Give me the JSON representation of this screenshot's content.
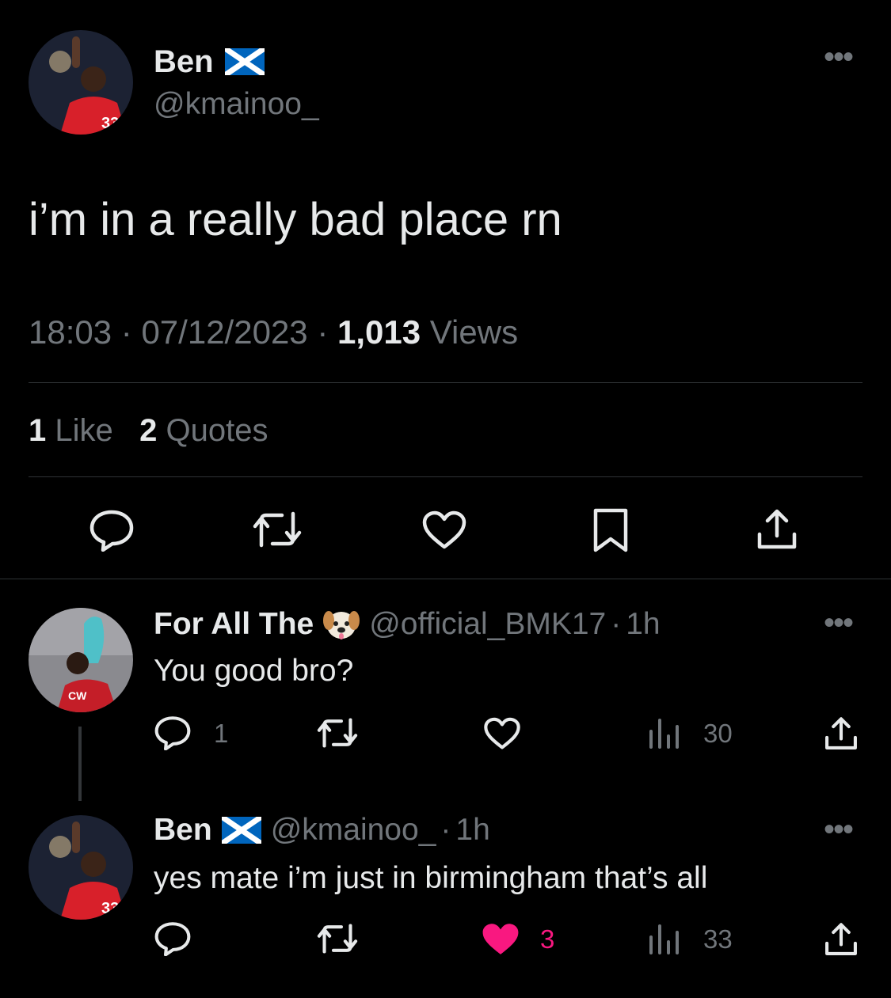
{
  "main_tweet": {
    "author_name": "Ben",
    "author_handle": "@kmainoo_",
    "text": "i’m in a really bad place rn",
    "time": "18:03",
    "date": "07/12/2023",
    "views_count": "1,013",
    "views_label": "Views",
    "likes_count": "1",
    "likes_label": "Like",
    "quotes_count": "2",
    "quotes_label": "Quotes",
    "actions": [
      "reply-icon",
      "retweet-icon",
      "like-icon",
      "bookmark-icon",
      "share-icon"
    ]
  },
  "replies": [
    {
      "author_name": "For All The",
      "author_emoji": "dog-face-emoji",
      "author_handle": "@official_BMK17",
      "time": "1h",
      "text": "You good bro?",
      "reply_count": "1",
      "retweet_count": "",
      "like_count": "",
      "views_count": "30",
      "liked": false
    },
    {
      "author_name": "Ben",
      "author_handle": "@kmainoo_",
      "time": "1h",
      "text": "yes mate i’m just in birmingham that’s all",
      "reply_count": "",
      "retweet_count": "",
      "like_count": "3",
      "views_count": "33",
      "liked": true
    }
  ],
  "separator": "·",
  "colors": {
    "background": "#000000",
    "text": "#e7e9ea",
    "secondary": "#71767b",
    "divider": "#2f3336",
    "like_active": "#f91880",
    "flag_blue": "#0065bd"
  }
}
